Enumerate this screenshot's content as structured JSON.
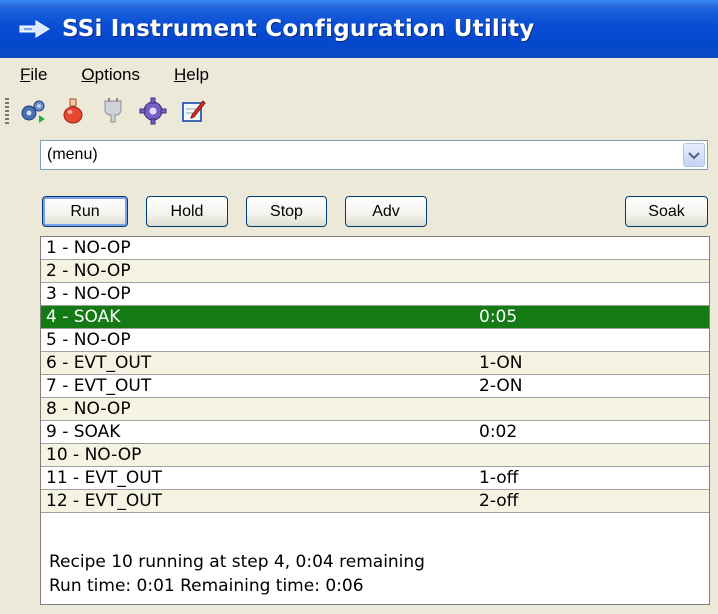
{
  "window": {
    "title": "SSi Instrument Configuration Utility"
  },
  "menu": [
    {
      "label": "File",
      "accel": "F",
      "rest": "ile"
    },
    {
      "label": "Options",
      "accel": "O",
      "rest": "ptions"
    },
    {
      "label": "Help",
      "accel": "H",
      "rest": "elp"
    }
  ],
  "toolbar": {
    "icons": [
      "gears-icon",
      "red-flask-icon",
      "gray-plug-icon",
      "purple-gear-icon",
      "edit-document-icon"
    ]
  },
  "selector": {
    "value": "(menu)"
  },
  "buttons": {
    "run": "Run",
    "hold": "Hold",
    "stop": "Stop",
    "adv": "Adv",
    "soak": "Soak"
  },
  "steps": [
    {
      "step": "1 - NO-OP",
      "value": ""
    },
    {
      "step": "2 - NO-OP",
      "value": ""
    },
    {
      "step": "3 - NO-OP",
      "value": ""
    },
    {
      "step": "4 - SOAK",
      "value": "0:05"
    },
    {
      "step": "5 - NO-OP",
      "value": ""
    },
    {
      "step": "6 - EVT_OUT",
      "value": "1-ON"
    },
    {
      "step": "7 - EVT_OUT",
      "value": "2-ON"
    },
    {
      "step": "8 - NO-OP",
      "value": ""
    },
    {
      "step": "9 - SOAK",
      "value": "0:02"
    },
    {
      "step": "10 - NO-OP",
      "value": ""
    },
    {
      "step": "11 - EVT_OUT",
      "value": "1-off"
    },
    {
      "step": "12 - EVT_OUT",
      "value": "2-off"
    }
  ],
  "selected_index": 3,
  "status": {
    "line1": "Recipe 10 running at step 4, 0:04 remaining",
    "line2": "Run time: 0:01 Remaining time: 0:06"
  },
  "colors": {
    "selected_row": "#147a14",
    "alt_row": "#f5f3e1",
    "title_bar": "#0548cf"
  }
}
